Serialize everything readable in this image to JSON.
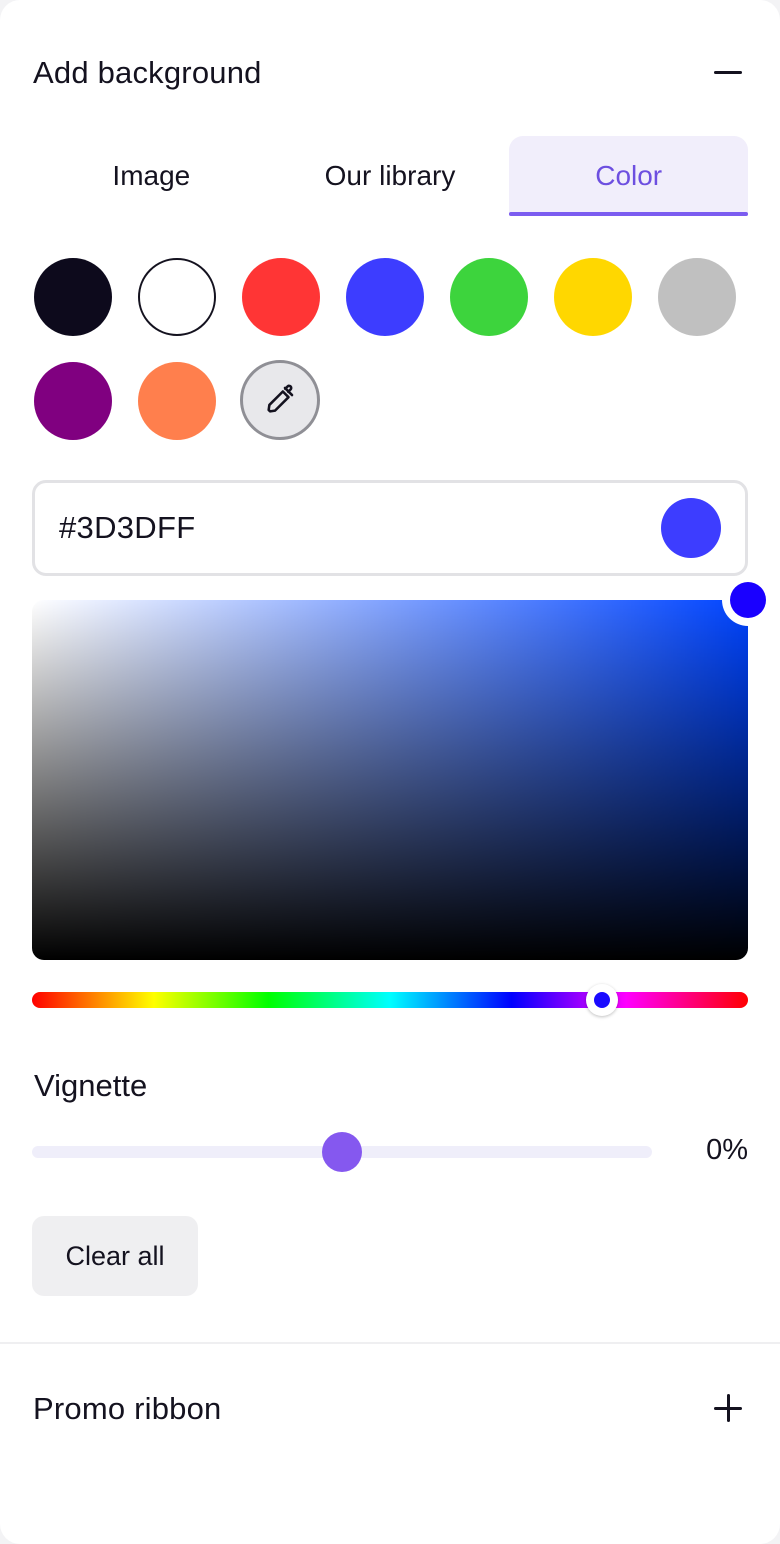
{
  "background_section": {
    "title": "Add background",
    "toggle_icon": "minus-icon"
  },
  "tabs": [
    {
      "label": "Image",
      "active": false
    },
    {
      "label": "Our library",
      "active": false
    },
    {
      "label": "Color",
      "active": true
    }
  ],
  "swatches": [
    {
      "name": "black",
      "color": "#0d0a1c"
    },
    {
      "name": "white",
      "color": "#ffffff"
    },
    {
      "name": "red",
      "color": "#ff3535"
    },
    {
      "name": "blue",
      "color": "#3d3dff"
    },
    {
      "name": "green",
      "color": "#3dd43d"
    },
    {
      "name": "yellow",
      "color": "#ffd700"
    },
    {
      "name": "gray",
      "color": "#c0c0c0"
    },
    {
      "name": "purple",
      "color": "#800080"
    },
    {
      "name": "orange",
      "color": "#ff7f4d"
    }
  ],
  "eyedropper_icon": "eyedropper-icon",
  "hex_input": {
    "value": "#3D3DFF",
    "preview_color": "#3d3dff"
  },
  "picker": {
    "hue_color": "#0044ff",
    "handle_color": "#1a00ff",
    "hue_handle_color": "#1a0aff"
  },
  "vignette": {
    "label": "Vignette",
    "value_text": "0%",
    "thumb_color": "#8558ef"
  },
  "clear_all_label": "Clear all",
  "promo_section": {
    "title": "Promo ribbon",
    "toggle_icon": "plus-icon"
  },
  "accent_color": "#7b5cf0"
}
